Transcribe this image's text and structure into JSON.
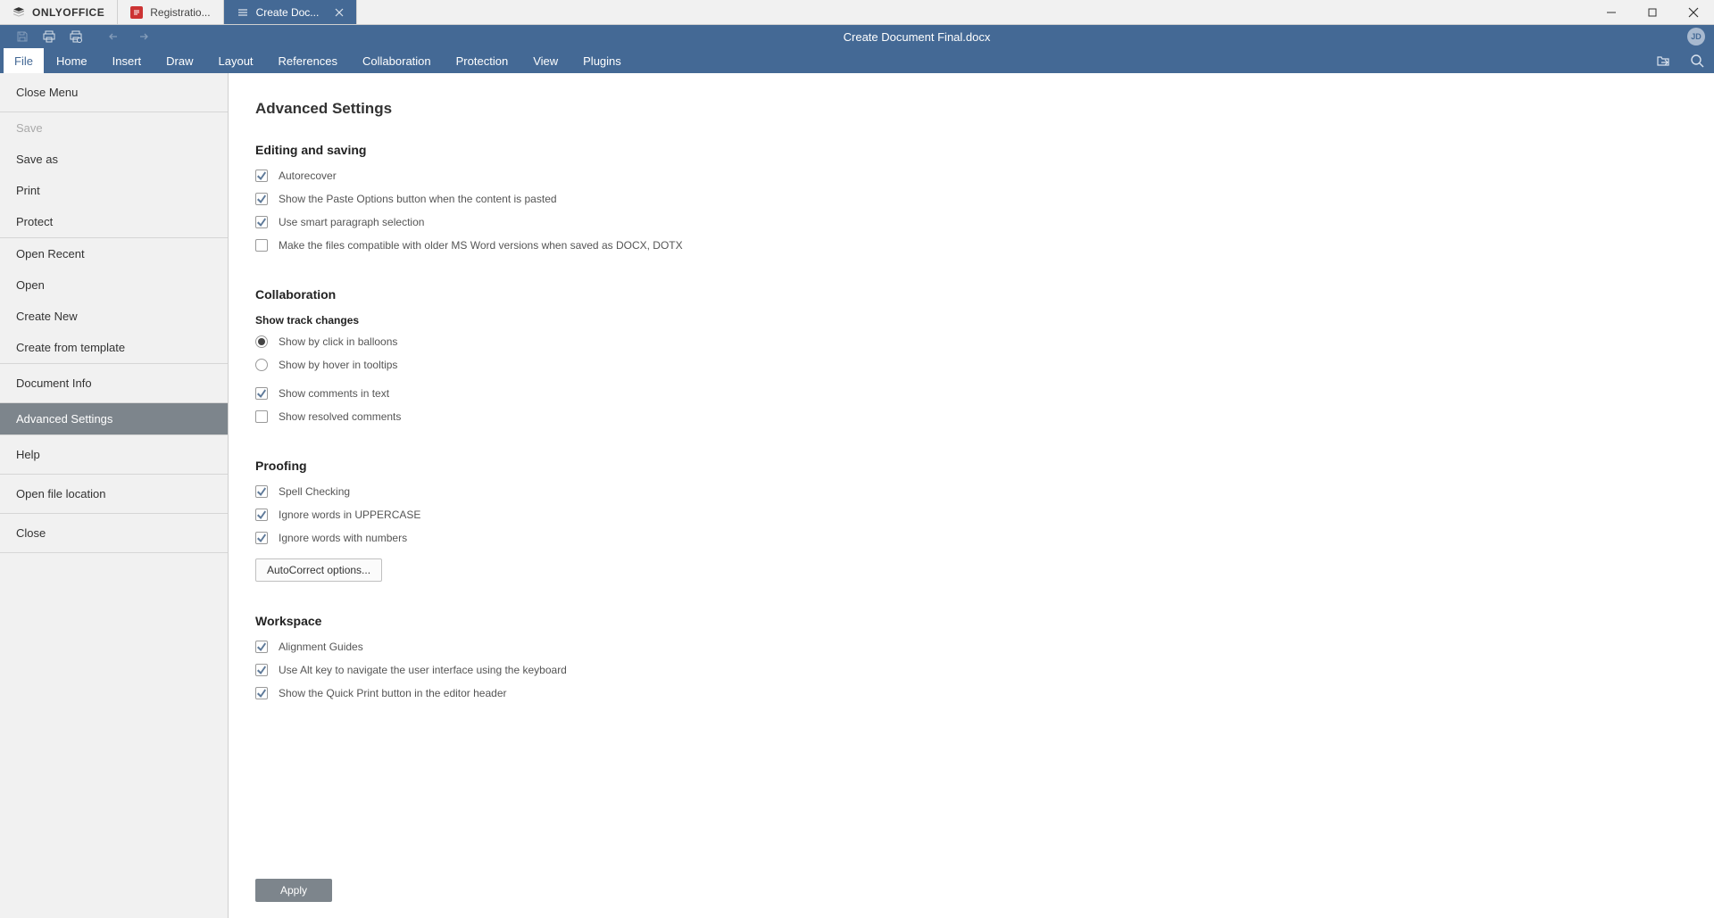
{
  "titlebar": {
    "brand": "ONLYOFFICE",
    "tabs": [
      {
        "label": "Registratio..."
      },
      {
        "label": "Create Doc..."
      }
    ]
  },
  "quickbar": {
    "document_title": "Create Document Final.docx",
    "avatar_initials": "JD"
  },
  "menubar": {
    "items": [
      "File",
      "Home",
      "Insert",
      "Draw",
      "Layout",
      "References",
      "Collaboration",
      "Protection",
      "View",
      "Plugins"
    ]
  },
  "sidebar": {
    "close_menu": "Close Menu",
    "save": "Save",
    "save_as": "Save as",
    "print": "Print",
    "protect": "Protect",
    "open_recent": "Open Recent",
    "open": "Open",
    "create_new": "Create New",
    "create_template": "Create from template",
    "doc_info": "Document Info",
    "adv_settings": "Advanced Settings",
    "help": "Help",
    "open_loc": "Open file location",
    "close": "Close"
  },
  "content": {
    "heading": "Advanced Settings",
    "editing": {
      "title": "Editing and saving",
      "autorecover": {
        "label": "Autorecover",
        "checked": true
      },
      "paste_options": {
        "label": "Show the Paste Options button when the content is pasted",
        "checked": true
      },
      "smart_para": {
        "label": "Use smart paragraph selection",
        "checked": true
      },
      "compat": {
        "label": "Make the files compatible with older MS Word versions when saved as DOCX, DOTX",
        "checked": false
      }
    },
    "collab": {
      "title": "Collaboration",
      "track_sub": "Show track changes",
      "rb_balloons": {
        "label": "Show by click in balloons",
        "selected": true
      },
      "rb_tooltips": {
        "label": "Show by hover in tooltips",
        "selected": false
      },
      "show_comments": {
        "label": "Show comments in text",
        "checked": true
      },
      "show_resolved": {
        "label": "Show resolved comments",
        "checked": false
      }
    },
    "proof": {
      "title": "Proofing",
      "spell": {
        "label": "Spell Checking",
        "checked": true
      },
      "upper": {
        "label": "Ignore words in UPPERCASE",
        "checked": true
      },
      "numbers": {
        "label": "Ignore words with numbers",
        "checked": true
      },
      "autocorrect_btn": "AutoCorrect options..."
    },
    "workspace": {
      "title": "Workspace",
      "guides": {
        "label": "Alignment Guides",
        "checked": true
      },
      "altkey": {
        "label": "Use Alt key to navigate the user interface using the keyboard",
        "checked": true
      },
      "quickprint": {
        "label": "Show the Quick Print button in the editor header",
        "checked": true
      }
    },
    "apply_btn": "Apply"
  }
}
